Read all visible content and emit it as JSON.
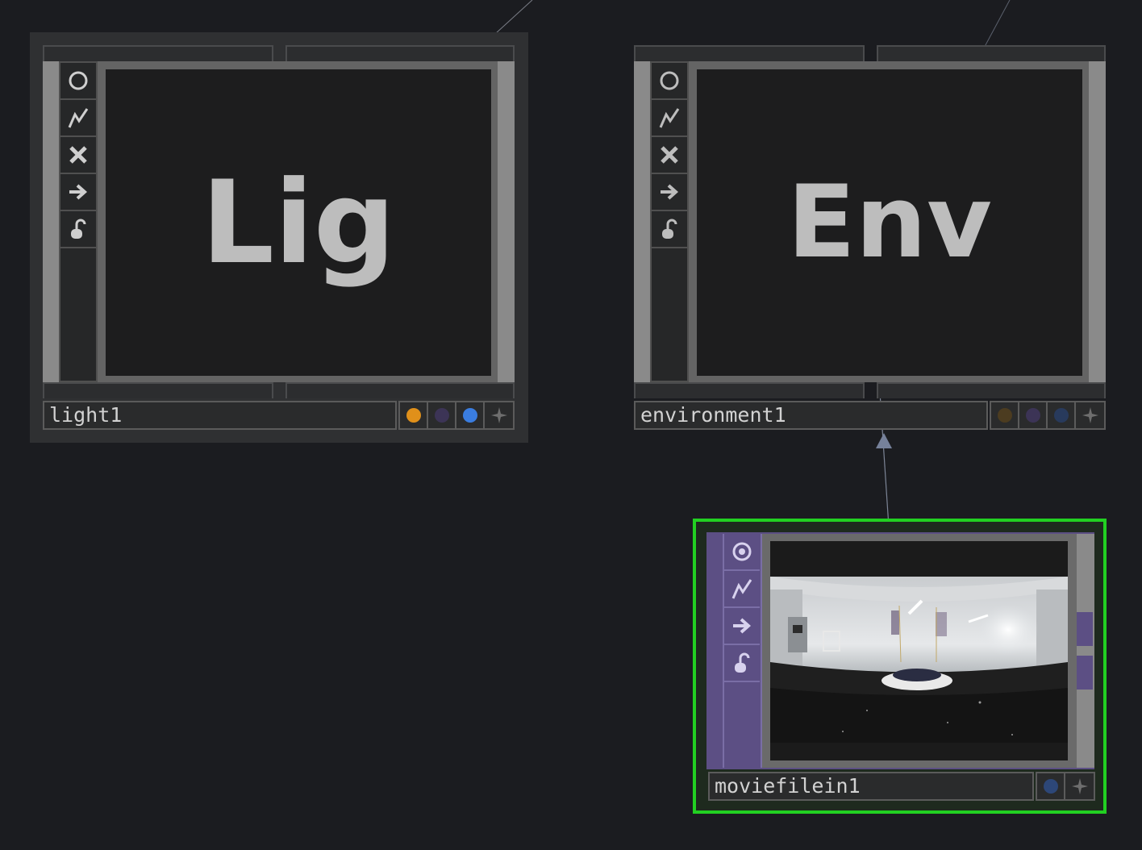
{
  "nodes": {
    "light": {
      "name": "light1",
      "viewer_text": "Lig",
      "toolbar": [
        "viewer-toggle-icon",
        "cook-icon",
        "bypass-icon",
        "export-icon",
        "lock-icon"
      ],
      "flags": [
        "render-flag",
        "display-flag",
        "pick-flag",
        "more-flag"
      ],
      "flag_colors": [
        "#e0901a",
        "#3c3456",
        "#3a7de0"
      ]
    },
    "environment": {
      "name": "environment1",
      "viewer_text": "Env",
      "toolbar": [
        "viewer-toggle-icon",
        "cook-icon",
        "bypass-icon",
        "export-icon",
        "lock-icon"
      ],
      "flags": [
        "render-flag",
        "display-flag",
        "pick-flag",
        "more-flag"
      ],
      "flag_colors": [
        "#4c3c20",
        "#3c3456",
        "#283a5c"
      ]
    },
    "moviefilein": {
      "name": "moviefilein1",
      "viewer_image": "equirectangular-panorama-room",
      "toolbar": [
        "viewer-toggle-icon",
        "cook-icon",
        "export-icon",
        "lock-icon"
      ],
      "flags": [
        "viewer-flag",
        "more-flag"
      ],
      "flag_colors": [
        "#2d4778"
      ],
      "selected_color": "#22d022",
      "family_color": "#5c4f84"
    }
  }
}
